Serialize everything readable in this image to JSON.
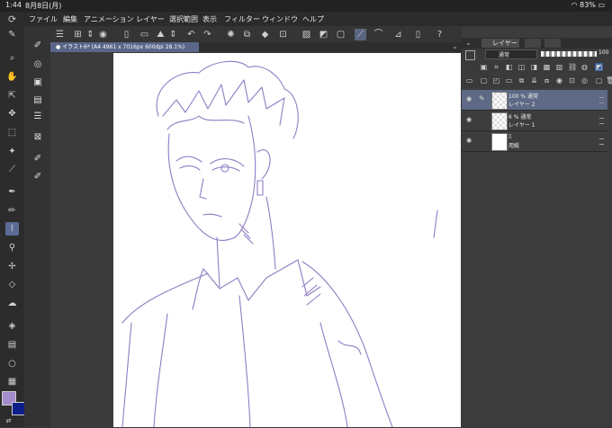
{
  "status": {
    "time": "1:44",
    "date": "8月8日(月)",
    "battery": "83%"
  },
  "menu": [
    "ファイル",
    "編集",
    "アニメーション",
    "レイヤー",
    "選択範囲",
    "表示",
    "フィルター",
    "ウィンドウ",
    "ヘルプ"
  ],
  "document": {
    "tab_label": "● イラスト6* (A4 4961 x 7016px 600dpi 28.1%)"
  },
  "layer_panel": {
    "tab_label": "レイヤー",
    "blend_mode": "通常",
    "opacity_value": "100",
    "layers": [
      {
        "line1": "100 % 通常",
        "line2": "レイヤー 2",
        "selected": true,
        "thumb": "check"
      },
      {
        "line1": "6 % 通常",
        "line2": "レイヤー 1",
        "selected": false,
        "thumb": "check"
      },
      {
        "line1": "",
        "line2": "用紙",
        "selected": false,
        "thumb": "paper"
      }
    ]
  },
  "colors": {
    "main": "#a58ccc",
    "sub": "#0f1f8a",
    "accent": "#5b6b94",
    "sketch": "#8f7cc4"
  },
  "icons": {
    "left_tools": [
      "pen-icon",
      "zoom-icon",
      "hand-icon",
      "move-icon",
      "operation-icon",
      "select-icon",
      "autoselect-icon",
      "eyedropper-icon",
      "pen2-icon",
      "pencil-icon",
      "brush-icon",
      "airbrush-icon",
      "decoration-icon",
      "eraser-icon",
      "blend-icon",
      "fill-icon",
      "gradient-icon",
      "figure-icon",
      "frame-icon"
    ]
  }
}
